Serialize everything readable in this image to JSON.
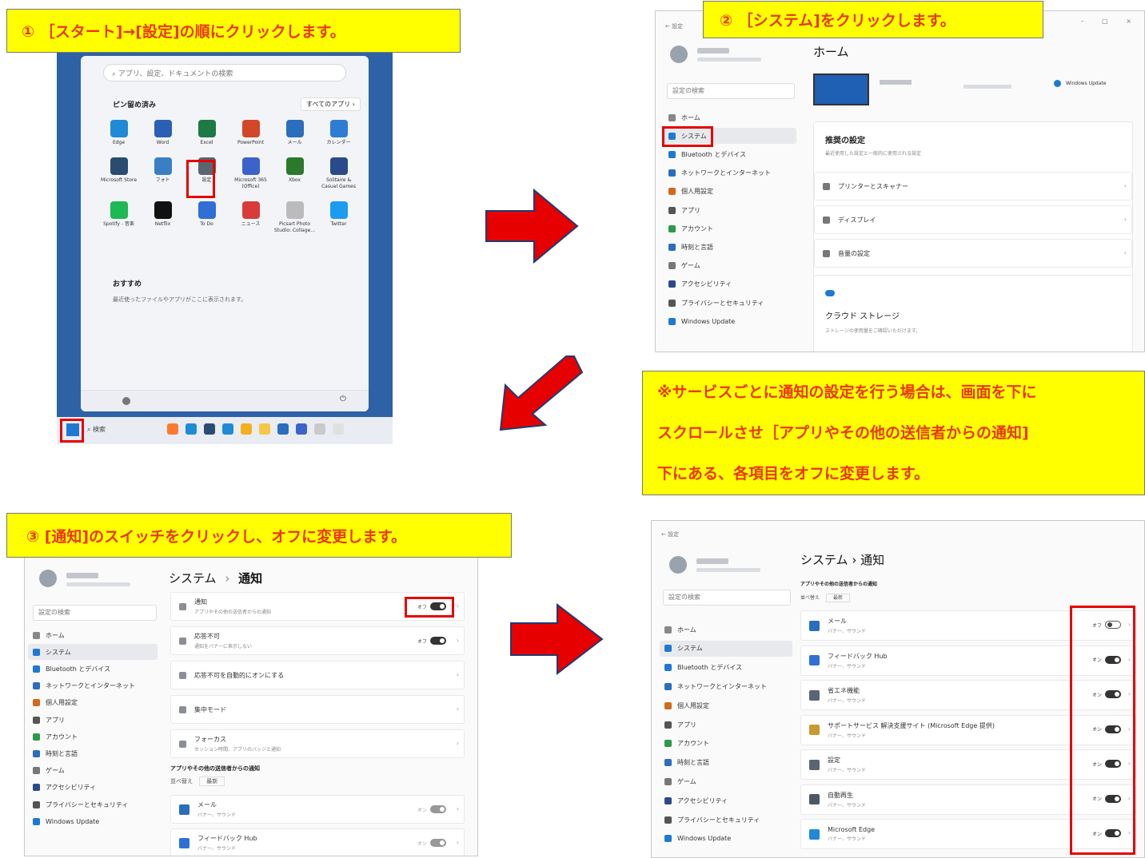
{
  "callouts": {
    "step1": "① ［スタート]→[設定]の順にクリックします。",
    "step2": "② ［システム]をクリックします。",
    "step3": "③ [通知]のスイッチをクリックし、オフに変更します。",
    "note_line1": "※サービスごとに通知の設定を行う場合は、画面を下に",
    "note_line2": "スクロールさせ［アプリやその他の送信者からの通知]",
    "note_line3": "下にある、各項目をオフに変更します。"
  },
  "colors": {
    "callout_bg": "#ffff00",
    "callout_text": "#e8380d",
    "highlight": "#e60000",
    "arrow": "#e60000",
    "arrow_outline": "#1f3b73",
    "start_bg": "#2d62a6"
  },
  "start_menu": {
    "search_placeholder": "アプリ、設定、ドキュメントの検索",
    "pinned_label": "ピン留め済み",
    "all_apps_button": "すべてのアプリ ›",
    "apps": [
      {
        "label": "Edge",
        "color": "#1f8ad6"
      },
      {
        "label": "Word",
        "color": "#2b5fb4"
      },
      {
        "label": "Excel",
        "color": "#1d7a45"
      },
      {
        "label": "PowerPoint",
        "color": "#d24726"
      },
      {
        "label": "メール",
        "color": "#2a6ebd"
      },
      {
        "label": "カレンダー",
        "color": "#2f7cd4"
      },
      {
        "label": "Microsoft Store",
        "color": "#2b4c72"
      },
      {
        "label": "フォト",
        "color": "#3a7fc4"
      },
      {
        "label": "設定",
        "color": "#5a6572"
      },
      {
        "label": "Microsoft 365 (Office)",
        "color": "#3b63c9"
      },
      {
        "label": "Xbox",
        "color": "#2b7a2b"
      },
      {
        "label": "Solitaire & Casual Games",
        "color": "#2a4a8a"
      },
      {
        "label": "Spotify - 音楽",
        "color": "#1db954"
      },
      {
        "label": "Netflix",
        "color": "#111111"
      },
      {
        "label": "To Do",
        "color": "#2f6fd6"
      },
      {
        "label": "ニュース",
        "color": "#d93b3b"
      },
      {
        "label": "Picsart Photo Studio: Collage...",
        "color": "#bbbbbb"
      },
      {
        "label": "Twitter",
        "color": "#1d9bf0"
      }
    ],
    "recommended_label": "おすすめ",
    "recommended_text": "最近使ったファイルやアプリがここに表示されます。",
    "power_icon": "⏻",
    "taskbar_search": "検索"
  },
  "settings_home": {
    "back": "← 設定",
    "window_controls": "– □ ×",
    "search_placeholder": "設定の検索",
    "title": "ホーム",
    "windows_update": "Windows Update",
    "recommended_title": "推奨の設定",
    "recommended_sub": "最近使用した設定と一般的に使用される設定",
    "rows": [
      "プリンターとスキャナー",
      "ディスプレイ",
      "音量の設定"
    ],
    "cloud_title": "クラウド ストレージ",
    "cloud_sub": "ストレージの使用量をご確認いただけます。"
  },
  "nav": [
    "ホーム",
    "システム",
    "Bluetooth とデバイス",
    "ネットワークとインターネット",
    "個人用設定",
    "アプリ",
    "アカウント",
    "時刻と言語",
    "ゲーム",
    "アクセシビリティ",
    "プライバシーとセキュリティ",
    "Windows Update"
  ],
  "notif_settings": {
    "search_placeholder": "設定の検索",
    "title_system": "システム",
    "title_sep": "›",
    "title_page": "通知",
    "rows": [
      {
        "label": "通知",
        "sub": "アプリやその他の送信者からの通知",
        "state": "オフ"
      },
      {
        "label": "応答不可",
        "sub": "通知をバナーに表示しない",
        "state": "オフ"
      },
      {
        "label": "応答不可を自動的にオンにする",
        "sub": ""
      },
      {
        "label": "集中モード",
        "sub": ""
      },
      {
        "label": "フォーカス",
        "sub": "セッション時間、アプリのバッジと通知"
      }
    ],
    "section": "アプリやその他の送信者からの通知",
    "sort_label": "並べ替え",
    "sort_value": "最新",
    "app_rows": [
      {
        "label": "メール",
        "sub": "バナー、サウンド",
        "state": "オン"
      },
      {
        "label": "フィードバック Hub",
        "sub": "バナー、サウンド",
        "state": "オン"
      }
    ]
  },
  "notif_apps": {
    "back": "← 設定",
    "search_placeholder": "設定の検索",
    "title": "システム › 通知",
    "section": "アプリやその他の送信者からの通知",
    "sort_label": "並べ替え",
    "sort_value": "最新",
    "rows": [
      {
        "label": "メール",
        "sub": "バナー、サウンド",
        "state": "オフ",
        "on": false,
        "color": "#2a6ebd"
      },
      {
        "label": "フィードバック Hub",
        "sub": "バナー、サウンド",
        "state": "オン",
        "on": true,
        "color": "#2f6fd6"
      },
      {
        "label": "省エネ機能",
        "sub": "バナー、サウンド",
        "state": "オン",
        "on": true,
        "color": "#596572"
      },
      {
        "label": "サポートサービス 解決支援サイト (Microsoft Edge 提供)",
        "sub": "バナー、サウンド",
        "state": "オン",
        "on": true,
        "color": "#c99a2e"
      },
      {
        "label": "設定",
        "sub": "バナー、サウンド",
        "state": "オン",
        "on": true,
        "color": "#5a6572"
      },
      {
        "label": "自動再生",
        "sub": "バナー、サウンド",
        "state": "オン",
        "on": true,
        "color": "#4a5866"
      },
      {
        "label": "Microsoft Edge",
        "sub": "バナー、サウンド",
        "state": "オン",
        "on": true,
        "color": "#1f8ad6"
      }
    ]
  }
}
